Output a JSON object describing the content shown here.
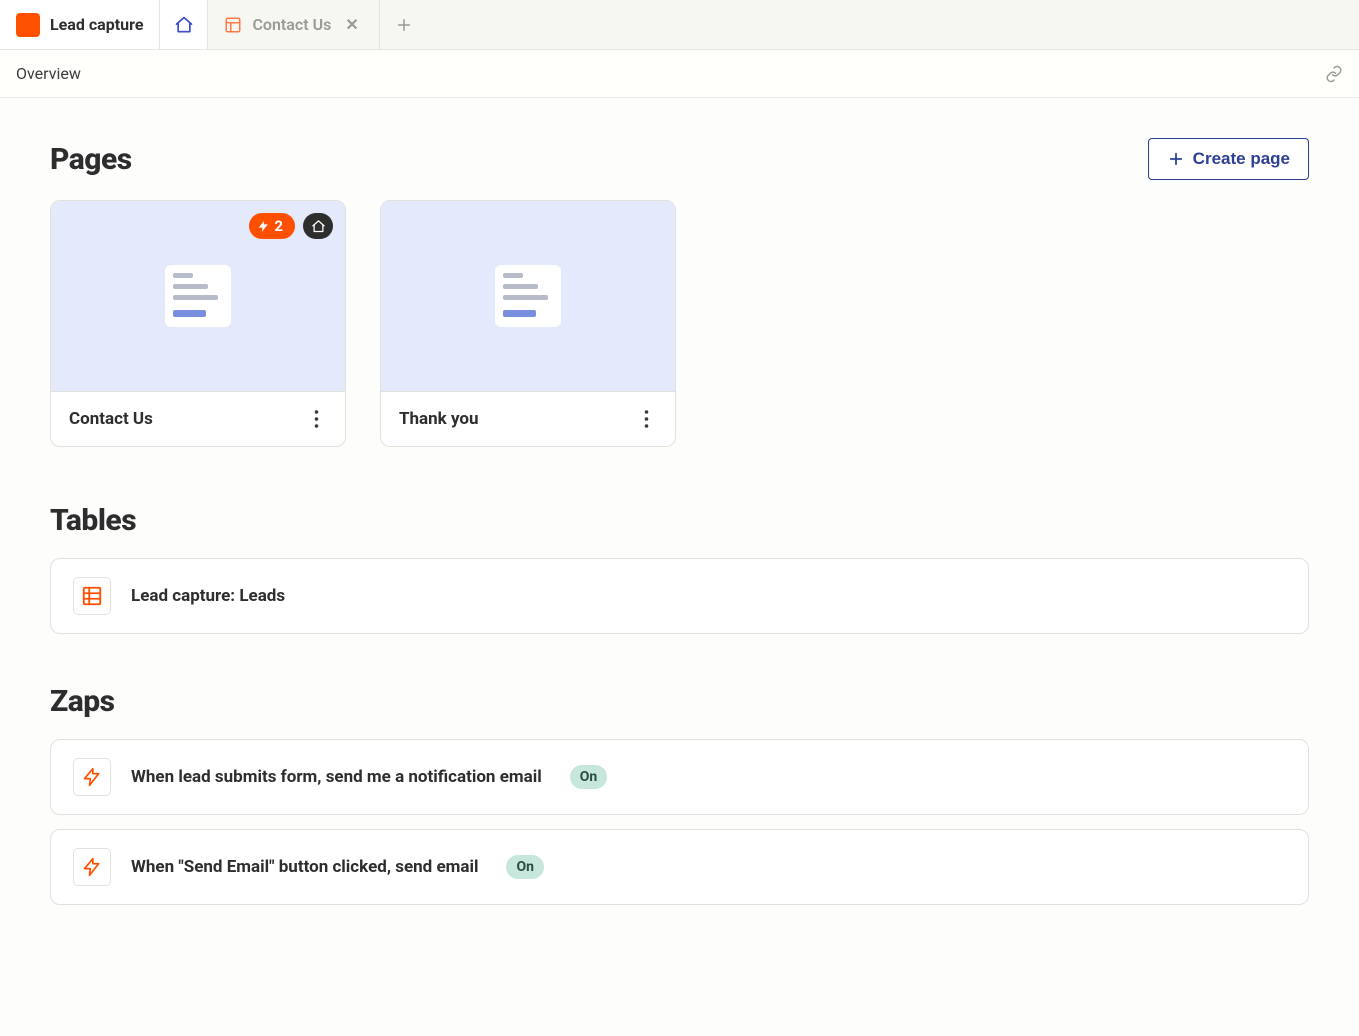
{
  "tabs": {
    "main": {
      "label": "Lead capture"
    },
    "page_tab": {
      "label": "Contact Us"
    }
  },
  "subheader": {
    "title": "Overview"
  },
  "sections": {
    "pages": {
      "title": "Pages",
      "create_label": "Create page"
    },
    "tables": {
      "title": "Tables"
    },
    "zaps": {
      "title": "Zaps"
    }
  },
  "pages": [
    {
      "name": "Contact Us",
      "zap_count": "2",
      "is_home": true
    },
    {
      "name": "Thank you",
      "zap_count": null,
      "is_home": false
    }
  ],
  "tables": [
    {
      "name": "Lead capture: Leads"
    }
  ],
  "zaps": [
    {
      "name": "When lead submits form, send me a notification email",
      "status": "On"
    },
    {
      "name": "When \"Send Email\" button clicked, send email",
      "status": "On"
    }
  ]
}
